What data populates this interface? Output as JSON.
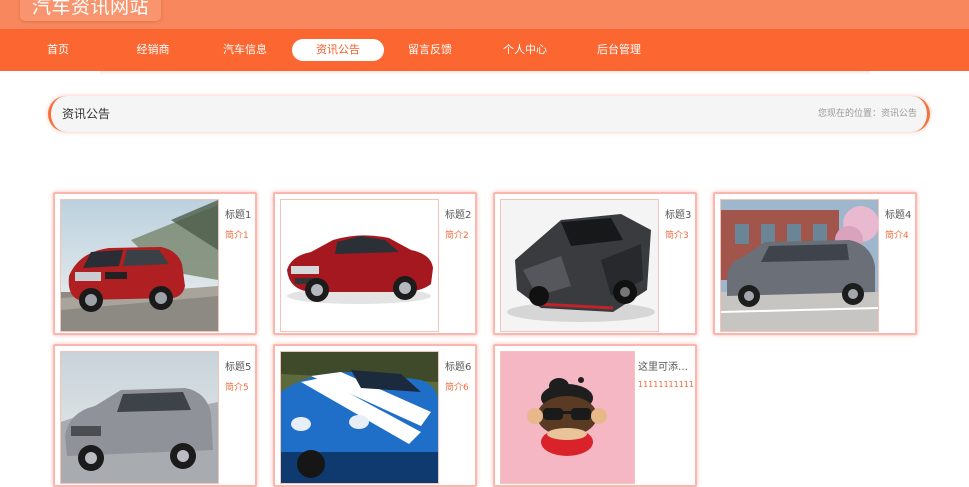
{
  "site": {
    "title": "汽车资讯网站"
  },
  "nav": {
    "items": [
      {
        "label": "首页"
      },
      {
        "label": "经销商"
      },
      {
        "label": "汽车信息"
      },
      {
        "label": "资讯公告",
        "active": true
      },
      {
        "label": "留言反馈"
      },
      {
        "label": "个人中心"
      },
      {
        "label": "后台管理"
      }
    ]
  },
  "breadcrumb": {
    "title": "资讯公告",
    "position": "您现在的位置：资讯公告"
  },
  "cards": [
    {
      "title": "标题1",
      "intro": "简介1",
      "image": "red-suv"
    },
    {
      "title": "标题2",
      "intro": "简介2",
      "image": "red-sedan"
    },
    {
      "title": "标题3",
      "intro": "简介3",
      "image": "black-supercar"
    },
    {
      "title": "标题4",
      "intro": "简介4",
      "image": "grey-minivan"
    },
    {
      "title": "标题5",
      "intro": "简介5",
      "image": "silver-suv"
    },
    {
      "title": "标题6",
      "intro": "简介6",
      "image": "blue-muscle-car"
    },
    {
      "title": "这里可添…",
      "intro": "111111111111",
      "image": "monkey-cartoon"
    }
  ],
  "colors": {
    "nav": "#fc6630",
    "topbar": "#f8875d",
    "accent": "#f26a3c",
    "card_border": "#fbb7ad"
  }
}
